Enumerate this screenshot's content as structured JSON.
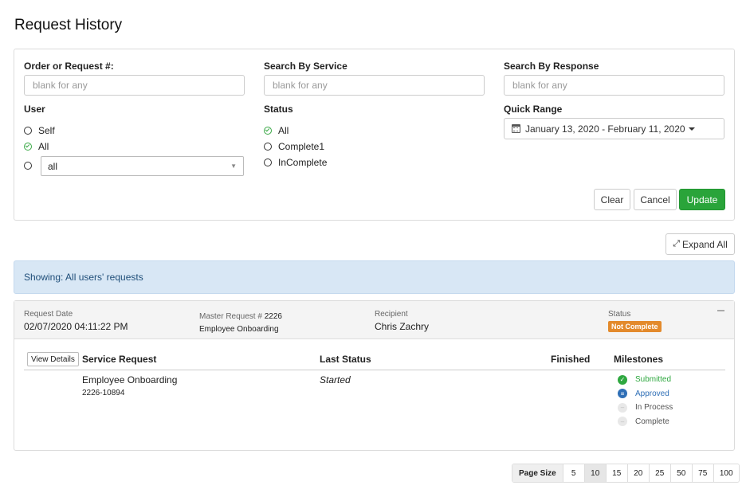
{
  "page": {
    "title": "Request History"
  },
  "filters": {
    "order_label": "Order or Request #:",
    "order_placeholder": "blank for any",
    "service_label": "Search By Service",
    "service_placeholder": "blank for any",
    "response_label": "Search By Response",
    "response_placeholder": "blank for any",
    "user_label": "User",
    "user_options": [
      {
        "label": "Self",
        "selected": false
      },
      {
        "label": "All",
        "selected": true
      }
    ],
    "user_select_value": "all",
    "status_label": "Status",
    "status_options": [
      {
        "label": "All",
        "selected": true
      },
      {
        "label": "Complete1",
        "selected": false
      },
      {
        "label": "InComplete",
        "selected": false
      }
    ],
    "quick_range_label": "Quick Range",
    "quick_range_value": "January 13, 2020 - February 11, 2020",
    "clear_label": "Clear",
    "cancel_label": "Cancel",
    "update_label": "Update"
  },
  "expand_all_label": "Expand All",
  "banner_text": "Showing: All users' requests",
  "request": {
    "date_label": "Request Date",
    "date_value": "02/07/2020 04:11:22 PM",
    "master_label": "Master Request #",
    "master_number": "2226",
    "master_name": "Employee Onboarding",
    "recipient_label": "Recipient",
    "recipient_value": "Chris Zachry",
    "status_label": "Status",
    "status_value": "Not Complete",
    "view_details_label": "View Details",
    "columns": {
      "service": "Service Request",
      "last_status": "Last Status",
      "finished": "Finished",
      "milestones": "Milestones"
    },
    "row": {
      "service_name": "Employee Onboarding",
      "service_id": "2226-10894",
      "last_status": "Started",
      "finished": ""
    },
    "milestones": [
      {
        "label": "Submitted",
        "state": "done"
      },
      {
        "label": "Approved",
        "state": "approved"
      },
      {
        "label": "In Process",
        "state": "pending"
      },
      {
        "label": "Complete",
        "state": "pending"
      }
    ]
  },
  "pager": {
    "label": "Page Size",
    "sizes": [
      "5",
      "10",
      "15",
      "20",
      "25",
      "50",
      "75",
      "100"
    ],
    "active": "10"
  },
  "colors": {
    "update_green": "#2aa43a",
    "banner_blue": "#d8e7f5",
    "status_orange": "#e38a2c",
    "milestone_done": "#2fa840",
    "milestone_approved": "#2f6fb6"
  },
  "icons": [
    "calendar-icon",
    "caret-down-icon",
    "expand-icon",
    "collapse-icon",
    "check-circle-icon",
    "approved-icon",
    "pending-icon"
  ]
}
